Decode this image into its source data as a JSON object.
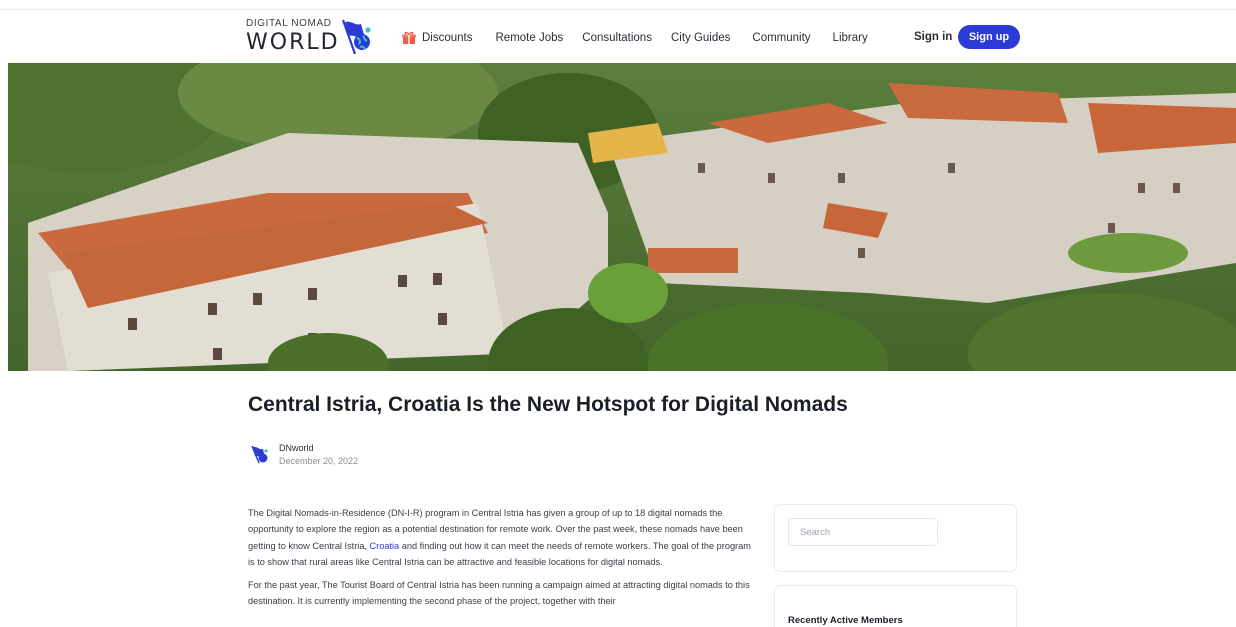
{
  "header": {
    "logo_small": "DIGITAL NOMAD",
    "logo_big": "WORLD",
    "nav": [
      {
        "label": "Discounts",
        "icon": "gift-icon"
      },
      {
        "label": "Remote Jobs"
      },
      {
        "label": "Consultations"
      },
      {
        "label": "City Guides"
      },
      {
        "label": "Community"
      },
      {
        "label": "Library"
      }
    ],
    "signin_label": "Sign in",
    "signup_label": "Sign up",
    "accent_color": "#2d3bd6"
  },
  "article": {
    "title": "Central Istria, Croatia Is the New Hotspot for Digital Nomads",
    "author": "DNworld",
    "date": "December 20, 2022",
    "p1_before": "The Digital Nomads-in-Residence (DN-I-R) program in Central Istria has given a group of up to 18 digital nomads the opportunity to explore the region as a potential destination for remote work. Over the past week, these nomads have been getting to know Central Istria, ",
    "p1_link": "Croatia",
    "p1_after": " and finding out how it can meet the needs of remote workers. The goal of the program is to show that rural areas like Central Istria can be attractive and feasible locations for digital nomads.",
    "p2": "For the past year, The Tourist Board of Central Istria has been running a campaign aimed at attracting digital nomads to this destination. It is currently implementing the second phase of the project, together with their"
  },
  "sidebar": {
    "search_placeholder": "Search",
    "members_title": "Recently Active Members"
  }
}
